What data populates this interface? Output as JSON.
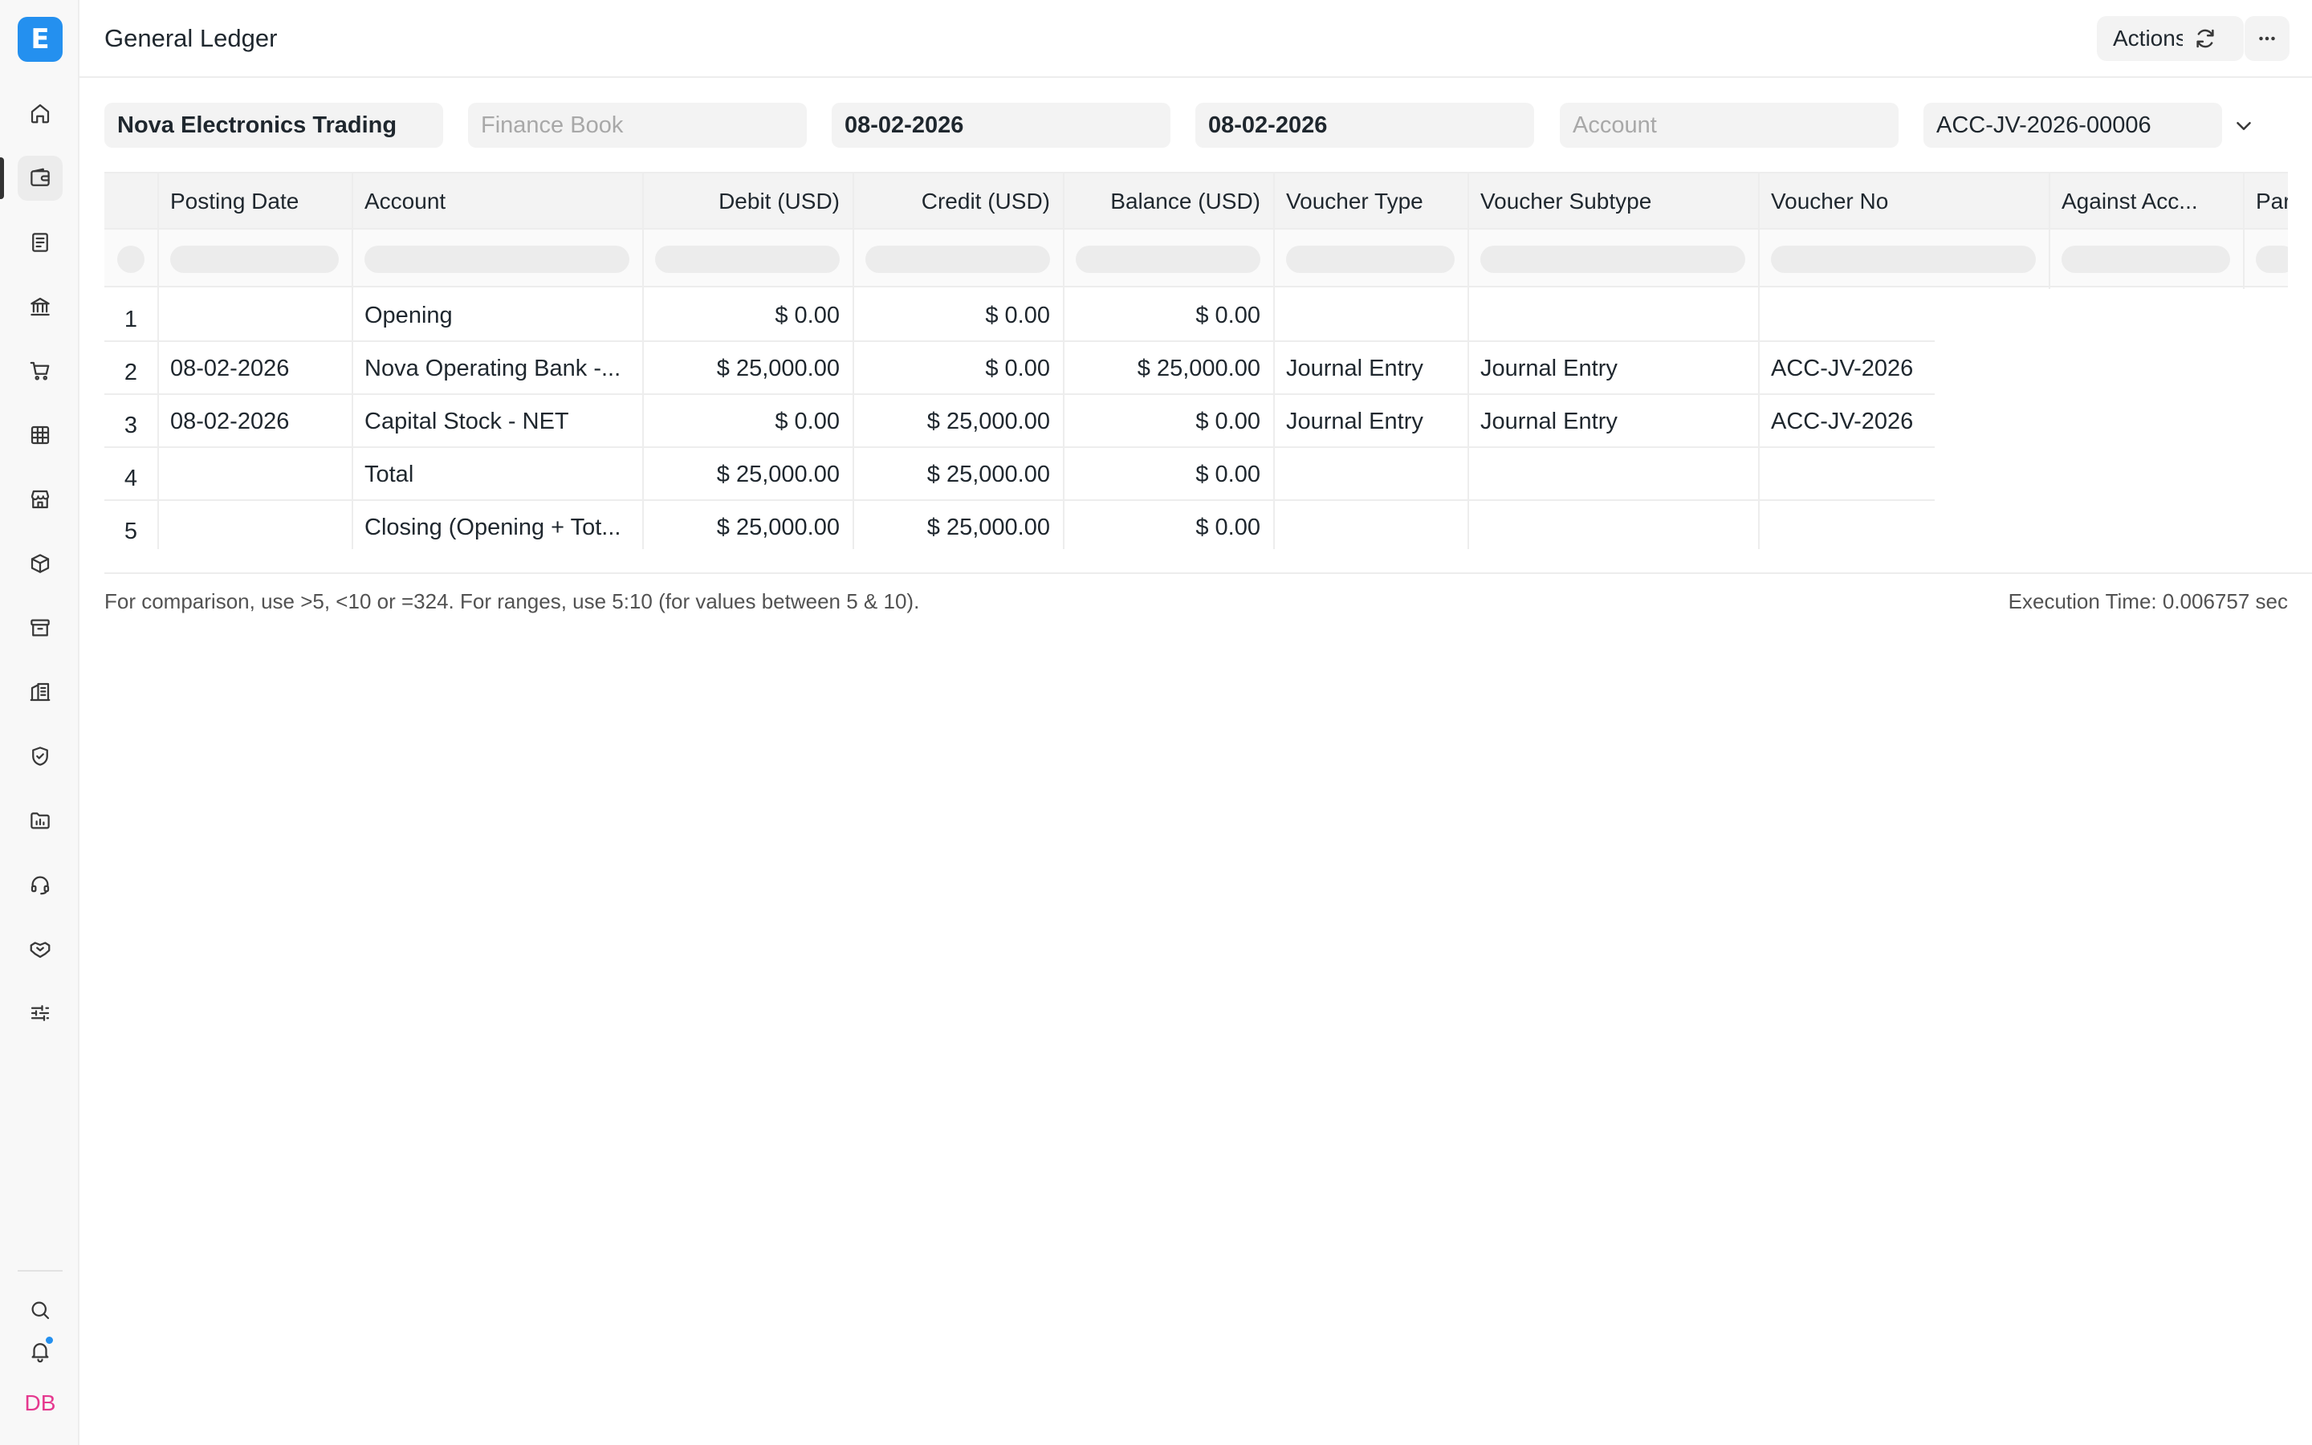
{
  "app": {
    "logo_letter": "E",
    "user_initials": "DB"
  },
  "header": {
    "title": "General Ledger",
    "actions_label": "Actions"
  },
  "sidebar": {
    "items": [
      "home-icon",
      "wallet-icon",
      "document-icon",
      "bank-icon",
      "cart-icon",
      "table-icon",
      "store-icon",
      "box-icon",
      "archive-icon",
      "building-icon",
      "shield-icon",
      "folder-chart-icon",
      "headset-icon",
      "handshake-icon",
      "sliders-icon"
    ],
    "bottom": [
      "search-icon",
      "bell-icon"
    ]
  },
  "filters": {
    "company": "Nova Electronics Trading",
    "finance_book_placeholder": "Finance Book",
    "from_date": "08-02-2026",
    "to_date": "08-02-2026",
    "account_placeholder": "Account",
    "voucher_no": "ACC-JV-2026-00006"
  },
  "table": {
    "columns": [
      "Posting Date",
      "Account",
      "Debit (USD)",
      "Credit (USD)",
      "Balance (USD)",
      "Voucher Type",
      "Voucher Subtype",
      "Voucher No",
      "Against Acc...",
      "Par"
    ],
    "rows": [
      {
        "idx": "1",
        "posting_date": "",
        "account": "Opening",
        "debit": "$ 0.00",
        "credit": "$ 0.00",
        "balance": "$ 0.00",
        "voucher_type": "",
        "voucher_subtype": "",
        "voucher_no": ""
      },
      {
        "idx": "2",
        "posting_date": "08-02-2026",
        "account": "Nova Operating Bank -...",
        "debit": "$ 25,000.00",
        "credit": "$ 0.00",
        "balance": "$ 25,000.00",
        "voucher_type": "Journal Entry",
        "voucher_subtype": "Journal Entry",
        "voucher_no": "ACC-JV-2026"
      },
      {
        "idx": "3",
        "posting_date": "08-02-2026",
        "account": "Capital Stock - NET",
        "debit": "$ 0.00",
        "credit": "$ 25,000.00",
        "balance": "$ 0.00",
        "voucher_type": "Journal Entry",
        "voucher_subtype": "Journal Entry",
        "voucher_no": "ACC-JV-2026"
      },
      {
        "idx": "4",
        "posting_date": "",
        "account": "Total",
        "debit": "$ 25,000.00",
        "credit": "$ 25,000.00",
        "balance": "$ 0.00",
        "voucher_type": "",
        "voucher_subtype": "",
        "voucher_no": ""
      },
      {
        "idx": "5",
        "posting_date": "",
        "account": "Closing (Opening + Tot...",
        "debit": "$ 25,000.00",
        "credit": "$ 25,000.00",
        "balance": "$ 0.00",
        "voucher_type": "",
        "voucher_subtype": "",
        "voucher_no": ""
      }
    ]
  },
  "footer": {
    "hint": "For comparison, use >5, <10 or =324. For ranges, use 5:10 (for values between 5 & 10).",
    "execution_time": "Execution Time: 0.006757 sec"
  }
}
